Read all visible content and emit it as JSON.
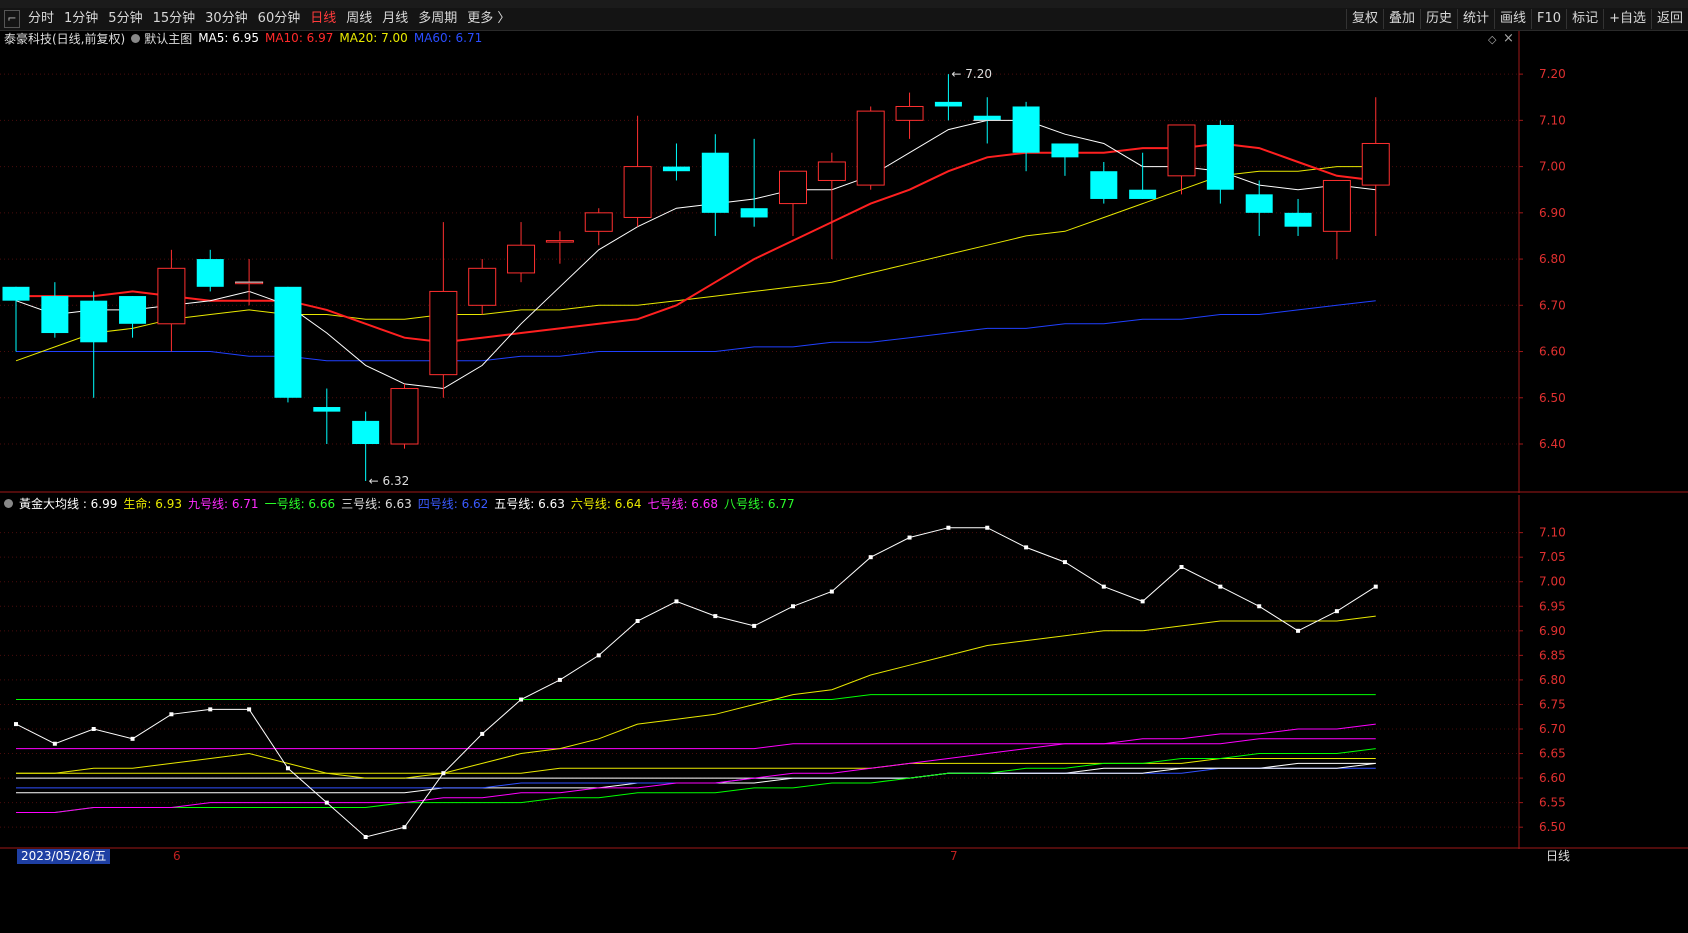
{
  "toolbar": {
    "periods": [
      "分时",
      "1分钟",
      "5分钟",
      "15分钟",
      "30分钟",
      "60分钟",
      "日线",
      "周线",
      "月线",
      "多周期",
      "更多 〉"
    ],
    "active_period": "日线",
    "right_buttons": [
      "复权",
      "叠加",
      "历史",
      "统计",
      "画线",
      "F10",
      "标记",
      "+自选",
      "返回"
    ]
  },
  "main_legend": {
    "stock": "泰豪科技(日线,前复权)",
    "chart_mode": "默认主图",
    "ma5": "MA5: 6.95",
    "ma10": "MA10: 6.97",
    "ma20": "MA20: 7.00",
    "ma60": "MA60: 6.71"
  },
  "sub_legend": {
    "gold": "黃金大均线 : 6.99",
    "life": "生命: 6.93",
    "line9": "九号线: 6.71",
    "line1": "一号线: 6.66",
    "line3": "三号线: 6.63",
    "line4": "四号线: 6.62",
    "line5": "五号线: 6.63",
    "line6": "六号线: 6.64",
    "line7": "七号线: 6.68",
    "line8": "八号线: 6.77"
  },
  "date_bar": {
    "cursor_date": "2023/05/26/五",
    "month_6": "6",
    "month_7": "7",
    "period": "日线"
  },
  "annotations": {
    "high": "7.20",
    "low": "6.32"
  },
  "colors": {
    "up": "#ff3030",
    "down": "#00ffff",
    "ma5": "#ffffff",
    "ma10": "#ff2020",
    "ma20": "#e8e800",
    "ma60": "#2040ff",
    "axis": "#e03030"
  },
  "chart_data": [
    {
      "type": "candlestick",
      "title": "泰豪科技(日线,前复权)",
      "y_ticks": [
        7.2,
        7.1,
        7.0,
        6.9,
        6.8,
        6.7,
        6.6,
        6.5,
        6.4
      ],
      "ylim": [
        6.32,
        7.25
      ],
      "candles": [
        {
          "o": 6.74,
          "h": 6.74,
          "l": 6.6,
          "c": 6.71
        },
        {
          "o": 6.72,
          "h": 6.75,
          "l": 6.63,
          "c": 6.64
        },
        {
          "o": 6.71,
          "h": 6.73,
          "l": 6.5,
          "c": 6.62
        },
        {
          "o": 6.72,
          "h": 6.72,
          "l": 6.63,
          "c": 6.66
        },
        {
          "o": 6.66,
          "h": 6.82,
          "l": 6.6,
          "c": 6.78
        },
        {
          "o": 6.8,
          "h": 6.82,
          "l": 6.73,
          "c": 6.74
        },
        {
          "o": 6.75,
          "h": 6.8,
          "l": 6.7,
          "c": 6.75
        },
        {
          "o": 6.74,
          "h": 6.74,
          "l": 6.49,
          "c": 6.5
        },
        {
          "o": 6.48,
          "h": 6.52,
          "l": 6.4,
          "c": 6.47
        },
        {
          "o": 6.45,
          "h": 6.47,
          "l": 6.32,
          "c": 6.4
        },
        {
          "o": 6.4,
          "h": 6.53,
          "l": 6.39,
          "c": 6.52
        },
        {
          "o": 6.55,
          "h": 6.88,
          "l": 6.5,
          "c": 6.73
        },
        {
          "o": 6.7,
          "h": 6.8,
          "l": 6.68,
          "c": 6.78
        },
        {
          "o": 6.77,
          "h": 6.88,
          "l": 6.75,
          "c": 6.83
        },
        {
          "o": 6.84,
          "h": 6.86,
          "l": 6.79,
          "c": 6.84
        },
        {
          "o": 6.86,
          "h": 6.91,
          "l": 6.83,
          "c": 6.9
        },
        {
          "o": 6.89,
          "h": 7.11,
          "l": 6.87,
          "c": 7.0
        },
        {
          "o": 7.0,
          "h": 7.05,
          "l": 6.97,
          "c": 6.99
        },
        {
          "o": 7.03,
          "h": 7.07,
          "l": 6.85,
          "c": 6.9
        },
        {
          "o": 6.91,
          "h": 7.06,
          "l": 6.87,
          "c": 6.89
        },
        {
          "o": 6.92,
          "h": 6.99,
          "l": 6.85,
          "c": 6.99
        },
        {
          "o": 6.97,
          "h": 7.03,
          "l": 6.8,
          "c": 7.01
        },
        {
          "o": 6.96,
          "h": 7.13,
          "l": 6.95,
          "c": 7.12
        },
        {
          "o": 7.1,
          "h": 7.16,
          "l": 7.06,
          "c": 7.13
        },
        {
          "o": 7.14,
          "h": 7.2,
          "l": 7.1,
          "c": 7.13
        },
        {
          "o": 7.11,
          "h": 7.15,
          "l": 7.05,
          "c": 7.1
        },
        {
          "o": 7.13,
          "h": 7.14,
          "l": 6.99,
          "c": 7.03
        },
        {
          "o": 7.05,
          "h": 7.05,
          "l": 6.98,
          "c": 7.02
        },
        {
          "o": 6.99,
          "h": 7.01,
          "l": 6.92,
          "c": 6.93
        },
        {
          "o": 6.95,
          "h": 7.03,
          "l": 6.93,
          "c": 6.93
        },
        {
          "o": 6.98,
          "h": 7.09,
          "l": 6.94,
          "c": 7.09
        },
        {
          "o": 7.09,
          "h": 7.1,
          "l": 6.92,
          "c": 6.95
        },
        {
          "o": 6.94,
          "h": 6.97,
          "l": 6.85,
          "c": 6.9
        },
        {
          "o": 6.9,
          "h": 6.93,
          "l": 6.85,
          "c": 6.87
        },
        {
          "o": 6.86,
          "h": 6.97,
          "l": 6.8,
          "c": 6.97
        },
        {
          "o": 6.96,
          "h": 7.15,
          "l": 6.85,
          "c": 7.05
        }
      ],
      "series": [
        {
          "name": "MA5",
          "color": "#ffffff",
          "values": [
            6.71,
            6.68,
            6.69,
            6.69,
            6.7,
            6.71,
            6.73,
            6.7,
            6.64,
            6.57,
            6.53,
            6.52,
            6.57,
            6.66,
            6.74,
            6.82,
            6.87,
            6.91,
            6.92,
            6.93,
            6.95,
            6.95,
            6.98,
            7.03,
            7.08,
            7.1,
            7.1,
            7.07,
            7.05,
            7.0,
            7.0,
            6.99,
            6.96,
            6.95,
            6.96,
            6.95
          ]
        },
        {
          "name": "MA10",
          "color": "#ff2020",
          "values": [
            6.72,
            6.72,
            6.72,
            6.73,
            6.72,
            6.71,
            6.71,
            6.71,
            6.69,
            6.66,
            6.63,
            6.62,
            6.63,
            6.64,
            6.65,
            6.66,
            6.67,
            6.7,
            6.75,
            6.8,
            6.84,
            6.88,
            6.92,
            6.95,
            6.99,
            7.02,
            7.03,
            7.03,
            7.03,
            7.04,
            7.04,
            7.05,
            7.04,
            7.01,
            6.98,
            6.97
          ]
        },
        {
          "name": "MA20",
          "color": "#e8e800",
          "values": [
            6.58,
            6.61,
            6.64,
            6.65,
            6.67,
            6.68,
            6.69,
            6.68,
            6.68,
            6.67,
            6.67,
            6.68,
            6.68,
            6.69,
            6.69,
            6.7,
            6.7,
            6.71,
            6.72,
            6.73,
            6.74,
            6.75,
            6.77,
            6.79,
            6.81,
            6.83,
            6.85,
            6.86,
            6.89,
            6.92,
            6.95,
            6.98,
            6.99,
            6.99,
            7.0,
            7.0
          ]
        },
        {
          "name": "MA60",
          "color": "#2040ff",
          "values": [
            6.6,
            6.6,
            6.6,
            6.6,
            6.6,
            6.6,
            6.59,
            6.59,
            6.58,
            6.58,
            6.58,
            6.58,
            6.58,
            6.59,
            6.59,
            6.6,
            6.6,
            6.6,
            6.6,
            6.61,
            6.61,
            6.62,
            6.62,
            6.63,
            6.64,
            6.65,
            6.65,
            6.66,
            6.66,
            6.67,
            6.67,
            6.68,
            6.68,
            6.69,
            6.7,
            6.71
          ]
        }
      ]
    },
    {
      "type": "line",
      "title": "黃金大均线",
      "y_ticks": [
        7.1,
        7.05,
        7.0,
        6.95,
        6.9,
        6.85,
        6.8,
        6.75,
        6.7,
        6.65,
        6.6,
        6.55,
        6.5
      ],
      "ylim": [
        6.48,
        7.14
      ],
      "series": [
        {
          "name": "黃金大均线",
          "color": "#ffffff",
          "values": [
            6.71,
            6.67,
            6.7,
            6.68,
            6.73,
            6.74,
            6.74,
            6.62,
            6.55,
            6.48,
            6.5,
            6.61,
            6.69,
            6.76,
            6.8,
            6.85,
            6.92,
            6.96,
            6.93,
            6.91,
            6.95,
            6.98,
            7.05,
            7.09,
            7.11,
            7.11,
            7.07,
            7.04,
            6.99,
            6.96,
            7.03,
            6.99,
            6.95,
            6.9,
            6.94,
            6.99
          ]
        },
        {
          "name": "生命",
          "color": "#e8e800",
          "values": [
            6.61,
            6.61,
            6.62,
            6.62,
            6.63,
            6.64,
            6.65,
            6.63,
            6.61,
            6.6,
            6.6,
            6.61,
            6.63,
            6.65,
            6.66,
            6.68,
            6.71,
            6.72,
            6.73,
            6.75,
            6.77,
            6.78,
            6.81,
            6.83,
            6.85,
            6.87,
            6.88,
            6.89,
            6.9,
            6.9,
            6.91,
            6.92,
            6.92,
            6.92,
            6.92,
            6.93
          ]
        },
        {
          "name": "九号线",
          "color": "#ff00ff",
          "values": [
            6.53,
            6.53,
            6.54,
            6.54,
            6.54,
            6.55,
            6.55,
            6.55,
            6.55,
            6.55,
            6.55,
            6.56,
            6.56,
            6.57,
            6.57,
            6.58,
            6.58,
            6.59,
            6.59,
            6.6,
            6.61,
            6.61,
            6.62,
            6.63,
            6.64,
            6.65,
            6.66,
            6.67,
            6.67,
            6.68,
            6.68,
            6.69,
            6.69,
            6.7,
            6.7,
            6.71
          ]
        },
        {
          "name": "一号线",
          "color": "#00ff00",
          "values": [
            6.53,
            6.53,
            6.54,
            6.54,
            6.54,
            6.54,
            6.54,
            6.54,
            6.54,
            6.54,
            6.55,
            6.55,
            6.55,
            6.55,
            6.56,
            6.56,
            6.57,
            6.57,
            6.57,
            6.58,
            6.58,
            6.59,
            6.59,
            6.6,
            6.61,
            6.61,
            6.62,
            6.62,
            6.63,
            6.63,
            6.64,
            6.64,
            6.65,
            6.65,
            6.65,
            6.66
          ]
        },
        {
          "name": "三号线",
          "color": "#ffffff",
          "values": [
            6.6,
            6.6,
            6.6,
            6.6,
            6.6,
            6.6,
            6.6,
            6.6,
            6.6,
            6.6,
            6.6,
            6.6,
            6.6,
            6.6,
            6.6,
            6.6,
            6.6,
            6.6,
            6.6,
            6.6,
            6.6,
            6.6,
            6.6,
            6.6,
            6.61,
            6.61,
            6.61,
            6.61,
            6.61,
            6.61,
            6.62,
            6.62,
            6.62,
            6.62,
            6.62,
            6.63
          ]
        },
        {
          "name": "四号线",
          "color": "#3050ff",
          "values": [
            6.58,
            6.58,
            6.58,
            6.58,
            6.58,
            6.58,
            6.58,
            6.58,
            6.58,
            6.58,
            6.58,
            6.58,
            6.58,
            6.59,
            6.59,
            6.59,
            6.59,
            6.59,
            6.59,
            6.6,
            6.6,
            6.6,
            6.6,
            6.6,
            6.61,
            6.61,
            6.61,
            6.61,
            6.61,
            6.61,
            6.61,
            6.62,
            6.62,
            6.62,
            6.62,
            6.62
          ]
        },
        {
          "name": "五号线",
          "color": "#ffffff",
          "values": [
            6.57,
            6.57,
            6.57,
            6.57,
            6.57,
            6.57,
            6.57,
            6.57,
            6.57,
            6.57,
            6.57,
            6.58,
            6.58,
            6.58,
            6.58,
            6.58,
            6.59,
            6.59,
            6.59,
            6.59,
            6.6,
            6.6,
            6.6,
            6.6,
            6.61,
            6.61,
            6.61,
            6.61,
            6.62,
            6.62,
            6.62,
            6.62,
            6.62,
            6.63,
            6.63,
            6.63
          ]
        },
        {
          "name": "六号线",
          "color": "#e8e800",
          "values": [
            6.61,
            6.61,
            6.61,
            6.61,
            6.61,
            6.61,
            6.61,
            6.61,
            6.61,
            6.61,
            6.61,
            6.61,
            6.61,
            6.61,
            6.62,
            6.62,
            6.62,
            6.62,
            6.62,
            6.62,
            6.62,
            6.62,
            6.62,
            6.63,
            6.63,
            6.63,
            6.63,
            6.63,
            6.63,
            6.63,
            6.63,
            6.64,
            6.64,
            6.64,
            6.64,
            6.64
          ]
        },
        {
          "name": "七号线",
          "color": "#ff00ff",
          "values": [
            6.66,
            6.66,
            6.66,
            6.66,
            6.66,
            6.66,
            6.66,
            6.66,
            6.66,
            6.66,
            6.66,
            6.66,
            6.66,
            6.66,
            6.66,
            6.66,
            6.66,
            6.66,
            6.66,
            6.66,
            6.67,
            6.67,
            6.67,
            6.67,
            6.67,
            6.67,
            6.67,
            6.67,
            6.67,
            6.67,
            6.67,
            6.67,
            6.68,
            6.68,
            6.68,
            6.68
          ]
        },
        {
          "name": "八号线",
          "color": "#00ff00",
          "values": [
            6.76,
            6.76,
            6.76,
            6.76,
            6.76,
            6.76,
            6.76,
            6.76,
            6.76,
            6.76,
            6.76,
            6.76,
            6.76,
            6.76,
            6.76,
            6.76,
            6.76,
            6.76,
            6.76,
            6.76,
            6.76,
            6.76,
            6.77,
            6.77,
            6.77,
            6.77,
            6.77,
            6.77,
            6.77,
            6.77,
            6.77,
            6.77,
            6.77,
            6.77,
            6.77,
            6.77
          ]
        }
      ]
    }
  ]
}
